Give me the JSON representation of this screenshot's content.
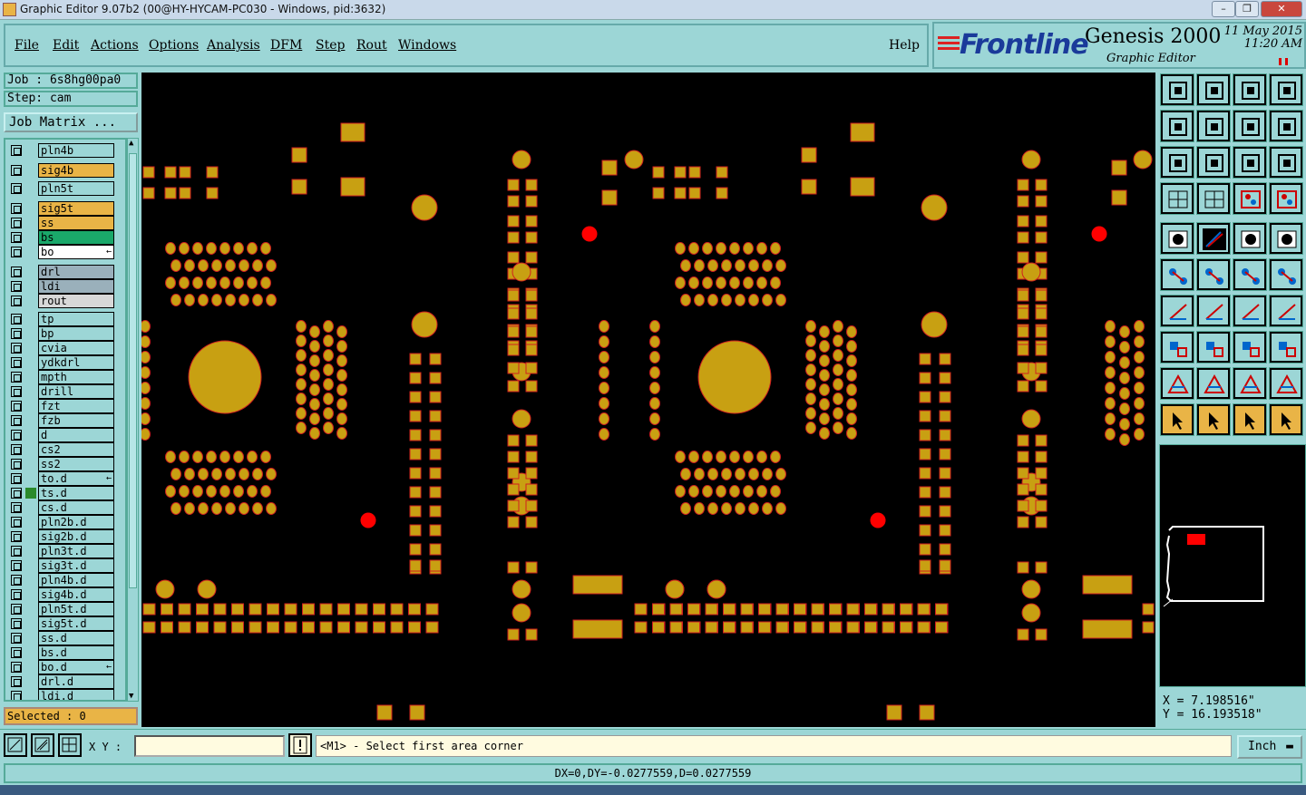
{
  "window": {
    "title": "Graphic Editor 9.07b2 (00@HY-HYCAM-PC030 - Windows, pid:3632)",
    "controls": [
      "minimize",
      "maximize",
      "close"
    ]
  },
  "menu": {
    "items": [
      "File",
      "Edit",
      "Actions",
      "Options",
      "Analysis",
      "DFM",
      "Step",
      "Rout",
      "Windows"
    ],
    "help": "Help"
  },
  "brand": {
    "logo": "Frontline",
    "product": "Genesis 2000",
    "subtitle": "Graphic Editor",
    "date": "11 May 2015",
    "time": "11:20 AM"
  },
  "job": {
    "job_label": "Job : 6s8hg00pa0",
    "step_label": "Step: cam",
    "matrix_button": "Job Matrix ..."
  },
  "layers": [
    {
      "name": "pln4b",
      "color": "#9cd6d6"
    },
    {
      "name": "sig4b",
      "color": "#e9b446"
    },
    {
      "name": "pln5t",
      "color": "#9cd6d6"
    },
    {
      "name": "sig5t",
      "color": "#e9b446"
    },
    {
      "name": "ss",
      "color": "#e9b446"
    },
    {
      "name": "bs",
      "color": "#1aa86a"
    },
    {
      "name": "bo",
      "color": "#ffffff",
      "arrow": true
    },
    {
      "name": "drl",
      "color": "#9ab0bb"
    },
    {
      "name": "ldi",
      "color": "#9ab0bb"
    },
    {
      "name": "rout",
      "color": "#d8d8d8"
    },
    {
      "name": "tp",
      "color": "#9cd6d6"
    },
    {
      "name": "bp",
      "color": "#9cd6d6"
    },
    {
      "name": "cvia",
      "color": "#9cd6d6"
    },
    {
      "name": "ydkdrl",
      "color": "#9cd6d6"
    },
    {
      "name": "mpth",
      "color": "#9cd6d6"
    },
    {
      "name": "drill",
      "color": "#9cd6d6"
    },
    {
      "name": "fzt",
      "color": "#9cd6d6"
    },
    {
      "name": "fzb",
      "color": "#9cd6d6"
    },
    {
      "name": "d",
      "color": "#9cd6d6"
    },
    {
      "name": "cs2",
      "color": "#9cd6d6"
    },
    {
      "name": "ss2",
      "color": "#9cd6d6"
    },
    {
      "name": "to.d",
      "color": "#9cd6d6",
      "arrow": true
    },
    {
      "name": "ts.d",
      "color": "#9cd6d6",
      "marker": true
    },
    {
      "name": "cs.d",
      "color": "#9cd6d6"
    },
    {
      "name": "pln2b.d",
      "color": "#9cd6d6"
    },
    {
      "name": "sig2b.d",
      "color": "#9cd6d6"
    },
    {
      "name": "pln3t.d",
      "color": "#9cd6d6"
    },
    {
      "name": "sig3t.d",
      "color": "#9cd6d6"
    },
    {
      "name": "pln4b.d",
      "color": "#9cd6d6"
    },
    {
      "name": "sig4b.d",
      "color": "#9cd6d6"
    },
    {
      "name": "pln5t.d",
      "color": "#9cd6d6"
    },
    {
      "name": "sig5t.d",
      "color": "#9cd6d6"
    },
    {
      "name": "ss.d",
      "color": "#9cd6d6"
    },
    {
      "name": "bs.d",
      "color": "#9cd6d6"
    },
    {
      "name": "bo.d",
      "color": "#9cd6d6",
      "arrow": true
    },
    {
      "name": "drl.d",
      "color": "#9cd6d6"
    },
    {
      "name": "ldi.d",
      "color": "#9cd6d6"
    }
  ],
  "selection": {
    "label": "Selected : 0"
  },
  "coordinates": {
    "x": "X = 7.198516\"",
    "y": "Y = 16.193518\""
  },
  "bottom": {
    "xy_label": "X Y :",
    "xy_value": "",
    "message": "<M1> - Select first area corner",
    "unit": "Inch",
    "status": "DX=0,DY=-0.0277559,D=0.0277559"
  },
  "tools": [
    "zoom-home-icon",
    "zoom-back-icon",
    "home-icon",
    "window-icon",
    "pan-left-icon",
    "pan-right-icon",
    "zoom-area-icon",
    "snap-icon",
    "fit-icon",
    "zoom-center-icon",
    "scale-1to2-icon",
    "help-icon",
    "ruler-icon",
    "grid-icon",
    "net-analyzer-icon",
    "net-compare-icon",
    "pad-icon",
    "line-icon",
    "measure-icon",
    "dot-icon",
    "snap-centers-icon",
    "intersect-icon",
    "point-line-icon",
    "point-point-icon",
    "angle-icon",
    "line-dist-icon",
    "rotate-icon",
    "flip-icon",
    "pad-dist-icon",
    "edge-dist-icon",
    "zoom-fit-icon",
    "select-group-icon",
    "triangle-icon",
    "triangle-up-icon",
    "triangle-a-icon",
    "triangle-cut-icon",
    "pointer-icon",
    "select-box-icon",
    "select-lasso-icon",
    "select-route-icon"
  ],
  "colors": {
    "background": "#9cd6d6",
    "pad": "#c8a012",
    "pad_edge": "#d02020",
    "red_fiducial": "#ff0000",
    "accent": "#e9b446"
  }
}
